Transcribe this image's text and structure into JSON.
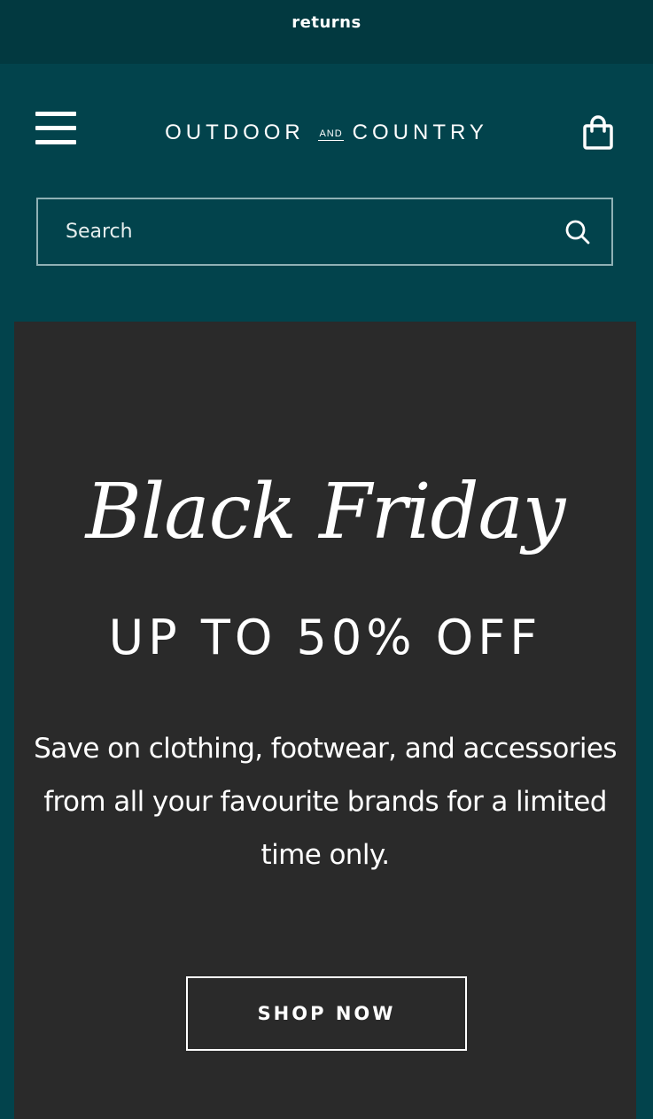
{
  "announcement": {
    "text": "returns"
  },
  "header": {
    "logo": {
      "part1": "OUTDOOR",
      "and": "AND",
      "part2": "COUNTRY"
    },
    "menu_icon": "hamburger-menu-icon",
    "cart_icon": "shopping-bag-icon"
  },
  "search": {
    "placeholder": "Search",
    "value": "",
    "icon": "search-icon"
  },
  "hero": {
    "title": "Black Friday",
    "subtitle": "UP TO 50% OFF",
    "description": "Save on clothing, footwear, and accessories from all your favourite brands for a limited time only.",
    "button_label": "SHOP NOW"
  },
  "colors": {
    "announcement_bg": "#023940",
    "header_bg": "#02434c",
    "hero_bg": "#2a2a2a",
    "text": "#ffffff",
    "search_border": "#8fb1b5"
  }
}
